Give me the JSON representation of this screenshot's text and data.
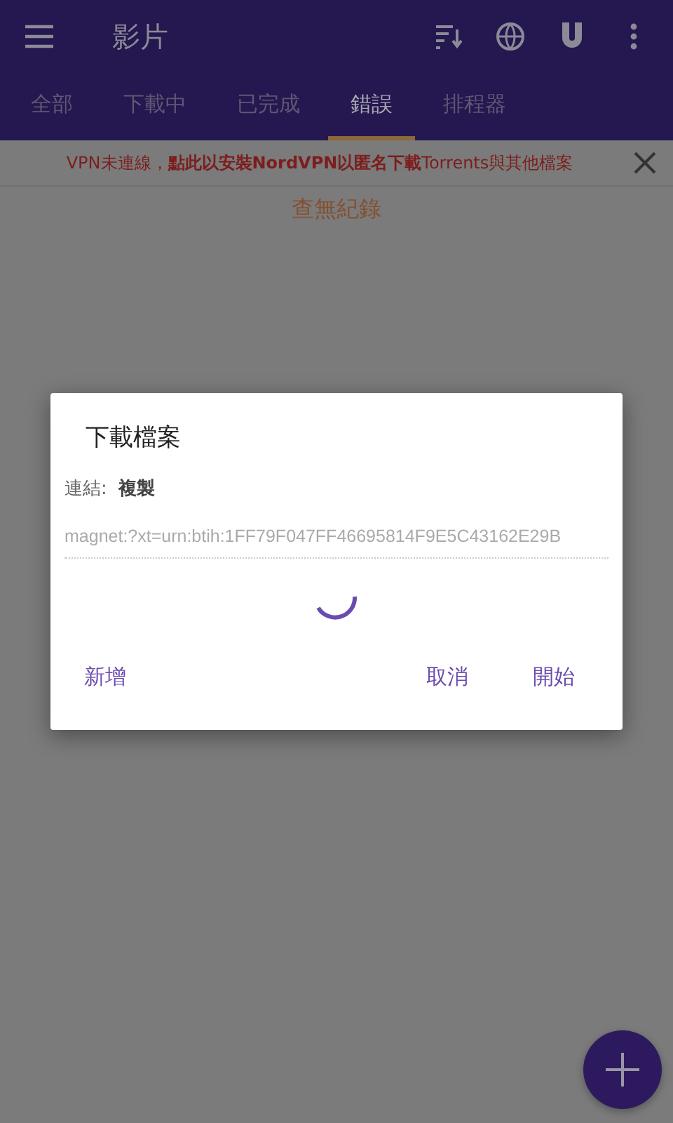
{
  "app_bar": {
    "title": "影片"
  },
  "tabs": [
    {
      "label": "全部",
      "selected": false
    },
    {
      "label": "下載中",
      "selected": false
    },
    {
      "label": "已完成",
      "selected": false
    },
    {
      "label": "錯誤",
      "selected": true
    },
    {
      "label": "排程器",
      "selected": false
    }
  ],
  "banner": {
    "text": "VPN未連線，**點此以安裝NordVPN以匿名下載**Torrents與其他檔案"
  },
  "empty_message": "查無紀錄",
  "dialog": {
    "title": "下載檔案",
    "link_label": "連結:",
    "link_action": "複製",
    "link_value": "magnet:?xt=urn:btih:1FF79F047FF46695814F9E5C43162E29B",
    "loading": true,
    "buttons": [
      {
        "label": "新增",
        "kind": "left"
      },
      {
        "label": "取消",
        "kind": "right"
      },
      {
        "label": "開始",
        "kind": "right"
      }
    ]
  }
}
